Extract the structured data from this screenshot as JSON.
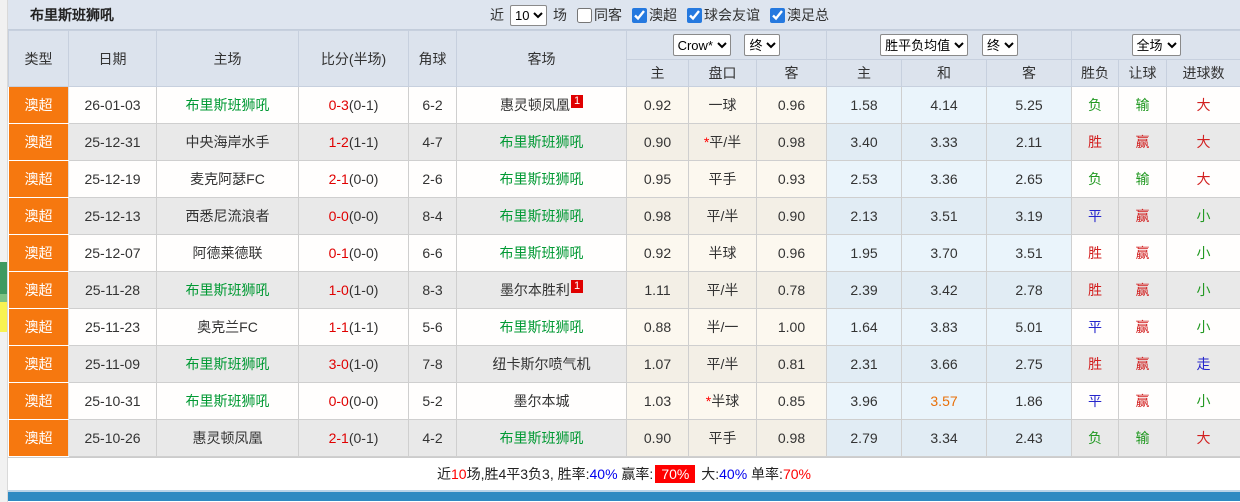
{
  "title": "布里斯班狮吼",
  "filter_bar": {
    "recent_label": "近",
    "recent_value": "10",
    "unit_label": "场",
    "checkboxes": [
      {
        "label": "同客",
        "checked": false
      },
      {
        "label": "澳超",
        "checked": true
      },
      {
        "label": "球会友谊",
        "checked": true
      },
      {
        "label": "澳足总",
        "checked": true
      }
    ]
  },
  "selectors": {
    "bookmaker": "Crow*",
    "asian_state": "终",
    "europe_metric": "胜平负均值",
    "europe_state": "终",
    "scope": "全场"
  },
  "columns": {
    "type": "类型",
    "date": "日期",
    "home": "主场",
    "score": "比分(半场)",
    "corners": "角球",
    "away": "客场",
    "asian_home": "主",
    "asian_line": "盘口",
    "asian_away": "客",
    "euro_home": "主",
    "euro_draw": "和",
    "euro_away": "客",
    "result": "胜负",
    "handicap_result": "让球",
    "goals": "进球数"
  },
  "rows": [
    {
      "league": "澳超",
      "date": "26-01-03",
      "home": "布里斯班狮吼",
      "home_highlight": true,
      "score_ft": "0-3",
      "score_ht": "(0-1)",
      "corners": "6-2",
      "away": "惠灵顿凤凰",
      "away_highlight": false,
      "away_badge": "1",
      "asian_home": "0.92",
      "asian_line": "一球",
      "asian_line_star": false,
      "asian_away": "0.96",
      "euro_home": "1.58",
      "euro_draw": "4.14",
      "euro_draw_hot": false,
      "euro_away": "5.25",
      "result": "负",
      "result_color": "green",
      "handicap_result": "输",
      "handicap_color": "green",
      "goals": "大",
      "goals_color": "red"
    },
    {
      "league": "澳超",
      "date": "25-12-31",
      "home": "中央海岸水手",
      "home_highlight": false,
      "score_ft": "1-2",
      "score_ht": "(1-1)",
      "corners": "4-7",
      "away": "布里斯班狮吼",
      "away_highlight": true,
      "away_badge": null,
      "asian_home": "0.90",
      "asian_line": "平/半",
      "asian_line_star": true,
      "asian_away": "0.98",
      "euro_home": "3.40",
      "euro_draw": "3.33",
      "euro_draw_hot": false,
      "euro_away": "2.11",
      "result": "胜",
      "result_color": "red",
      "handicap_result": "赢",
      "handicap_color": "red",
      "goals": "大",
      "goals_color": "red"
    },
    {
      "league": "澳超",
      "date": "25-12-19",
      "home": "麦克阿瑟FC",
      "home_highlight": false,
      "score_ft": "2-1",
      "score_ht": "(0-0)",
      "corners": "2-6",
      "away": "布里斯班狮吼",
      "away_highlight": true,
      "away_badge": null,
      "asian_home": "0.95",
      "asian_line": "平手",
      "asian_line_star": false,
      "asian_away": "0.93",
      "euro_home": "2.53",
      "euro_draw": "3.36",
      "euro_draw_hot": false,
      "euro_away": "2.65",
      "result": "负",
      "result_color": "green",
      "handicap_result": "输",
      "handicap_color": "green",
      "goals": "大",
      "goals_color": "red"
    },
    {
      "league": "澳超",
      "date": "25-12-13",
      "home": "西悉尼流浪者",
      "home_highlight": false,
      "score_ft": "0-0",
      "score_ht": "(0-0)",
      "corners": "8-4",
      "away": "布里斯班狮吼",
      "away_highlight": true,
      "away_badge": null,
      "asian_home": "0.98",
      "asian_line": "平/半",
      "asian_line_star": false,
      "asian_away": "0.90",
      "euro_home": "2.13",
      "euro_draw": "3.51",
      "euro_draw_hot": false,
      "euro_away": "3.19",
      "result": "平",
      "result_color": "blue",
      "handicap_result": "赢",
      "handicap_color": "red",
      "goals": "小",
      "goals_color": "green"
    },
    {
      "league": "澳超",
      "date": "25-12-07",
      "home": "阿德莱德联",
      "home_highlight": false,
      "score_ft": "0-1",
      "score_ht": "(0-0)",
      "corners": "6-6",
      "away": "布里斯班狮吼",
      "away_highlight": true,
      "away_badge": null,
      "asian_home": "0.92",
      "asian_line": "半球",
      "asian_line_star": false,
      "asian_away": "0.96",
      "euro_home": "1.95",
      "euro_draw": "3.70",
      "euro_draw_hot": false,
      "euro_away": "3.51",
      "result": "胜",
      "result_color": "red",
      "handicap_result": "赢",
      "handicap_color": "red",
      "goals": "小",
      "goals_color": "green"
    },
    {
      "league": "澳超",
      "date": "25-11-28",
      "home": "布里斯班狮吼",
      "home_highlight": true,
      "score_ft": "1-0",
      "score_ht": "(1-0)",
      "corners": "8-3",
      "away": "墨尔本胜利",
      "away_highlight": false,
      "away_badge": "1",
      "asian_home": "1.11",
      "asian_line": "平/半",
      "asian_line_star": false,
      "asian_away": "0.78",
      "euro_home": "2.39",
      "euro_draw": "3.42",
      "euro_draw_hot": false,
      "euro_away": "2.78",
      "result": "胜",
      "result_color": "red",
      "handicap_result": "赢",
      "handicap_color": "red",
      "goals": "小",
      "goals_color": "green"
    },
    {
      "league": "澳超",
      "date": "25-11-23",
      "home": "奥克兰FC",
      "home_highlight": false,
      "score_ft": "1-1",
      "score_ht": "(1-1)",
      "corners": "5-6",
      "away": "布里斯班狮吼",
      "away_highlight": true,
      "away_badge": null,
      "asian_home": "0.88",
      "asian_line": "半/一",
      "asian_line_star": false,
      "asian_away": "1.00",
      "euro_home": "1.64",
      "euro_draw": "3.83",
      "euro_draw_hot": false,
      "euro_away": "5.01",
      "result": "平",
      "result_color": "blue",
      "handicap_result": "赢",
      "handicap_color": "red",
      "goals": "小",
      "goals_color": "green"
    },
    {
      "league": "澳超",
      "date": "25-11-09",
      "home": "布里斯班狮吼",
      "home_highlight": true,
      "score_ft": "3-0",
      "score_ht": "(1-0)",
      "corners": "7-8",
      "away": "纽卡斯尔喷气机",
      "away_highlight": false,
      "away_badge": null,
      "asian_home": "1.07",
      "asian_line": "平/半",
      "asian_line_star": false,
      "asian_away": "0.81",
      "euro_home": "2.31",
      "euro_draw": "3.66",
      "euro_draw_hot": false,
      "euro_away": "2.75",
      "result": "胜",
      "result_color": "red",
      "handicap_result": "赢",
      "handicap_color": "red",
      "goals": "走",
      "goals_color": "blue"
    },
    {
      "league": "澳超",
      "date": "25-10-31",
      "home": "布里斯班狮吼",
      "home_highlight": true,
      "score_ft": "0-0",
      "score_ht": "(0-0)",
      "corners": "5-2",
      "away": "墨尔本城",
      "away_highlight": false,
      "away_badge": null,
      "asian_home": "1.03",
      "asian_line": "半球",
      "asian_line_star": true,
      "asian_away": "0.85",
      "euro_home": "3.96",
      "euro_draw": "3.57",
      "euro_draw_hot": true,
      "euro_away": "1.86",
      "result": "平",
      "result_color": "blue",
      "handicap_result": "赢",
      "handicap_color": "red",
      "goals": "小",
      "goals_color": "green"
    },
    {
      "league": "澳超",
      "date": "25-10-26",
      "home": "惠灵顿凤凰",
      "home_highlight": false,
      "score_ft": "2-1",
      "score_ht": "(0-1)",
      "corners": "4-2",
      "away": "布里斯班狮吼",
      "away_highlight": true,
      "away_badge": null,
      "asian_home": "0.90",
      "asian_line": "平手",
      "asian_line_star": false,
      "asian_away": "0.98",
      "euro_home": "2.79",
      "euro_draw": "3.34",
      "euro_draw_hot": false,
      "euro_away": "2.43",
      "result": "负",
      "result_color": "green",
      "handicap_result": "输",
      "handicap_color": "green",
      "goals": "大",
      "goals_color": "red"
    }
  ],
  "summary": {
    "prefix": "近",
    "count": "10",
    "mid": "场,胜4平3负3, 胜率:",
    "win_rate": "40%",
    "yl_label": " 赢率:",
    "yl_value": "70%",
    "big_label": " 大:",
    "big_value": "40%",
    "dan_label": " 单率:",
    "dan_value": "70%"
  },
  "colors": {
    "accent_orange": "#f6780f",
    "team_green": "#009933",
    "score_red": "#e00000",
    "win_red": "#d22020",
    "lose_green": "#229922",
    "draw_blue": "#2525cc",
    "hot_orange": "#e8700a",
    "header_bg": "#dce3ed",
    "asian_bg": "#fcf8ef",
    "euro_bg": "#eaf4fb",
    "bottom_bar": "#2e8ac2"
  }
}
